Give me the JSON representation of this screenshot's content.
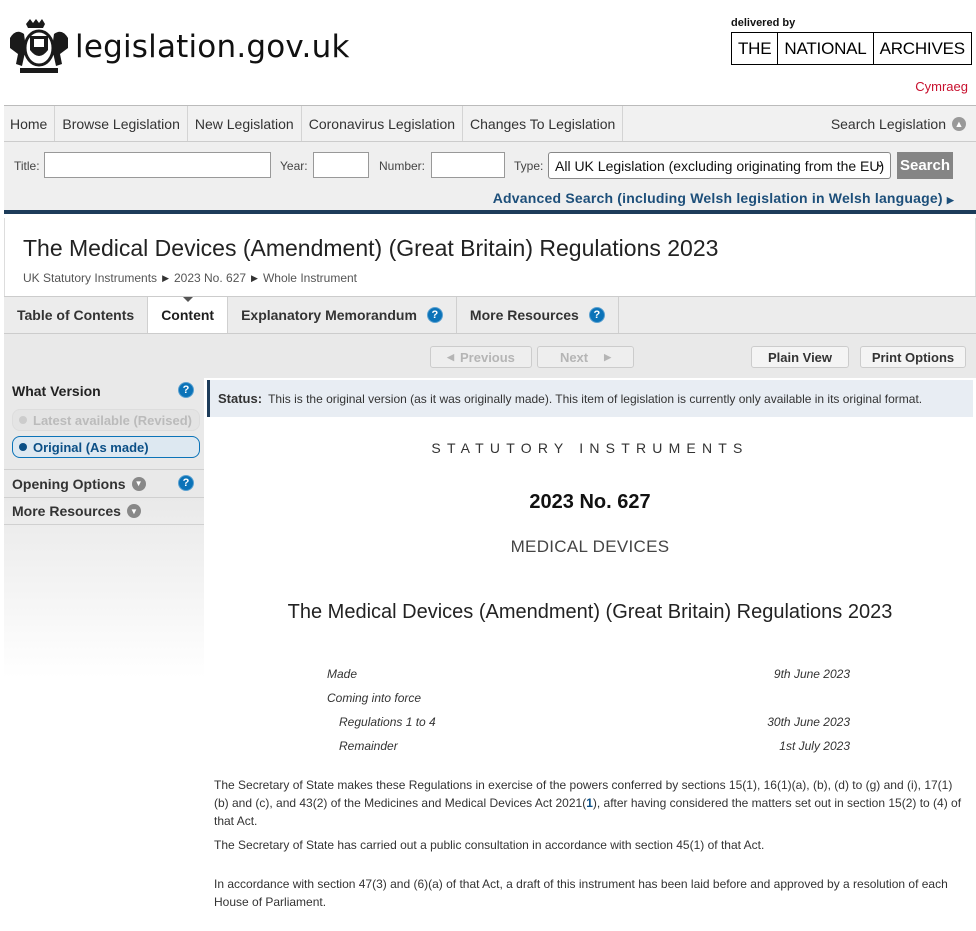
{
  "header": {
    "site_name": "legislation.gov.uk",
    "delivered_by": "delivered by",
    "tna_parts": [
      "THE",
      "NATIONAL",
      "ARCHIVES"
    ],
    "language_link": "Cymraeg"
  },
  "nav": {
    "items": [
      "Home",
      "Browse Legislation",
      "New Legislation",
      "Coronavirus Legislation",
      "Changes To Legislation"
    ],
    "search_label": "Search Legislation"
  },
  "search": {
    "title_label": "Title:",
    "year_label": "Year:",
    "number_label": "Number:",
    "type_label": "Type:",
    "type_value": "All UK Legislation (excluding originating from the EU)",
    "button": "Search",
    "advanced": "Advanced Search (including Welsh legislation in Welsh language)"
  },
  "document": {
    "title": "The Medical Devices (Amendment) (Great Britain) Regulations 2023",
    "breadcrumb": [
      "UK Statutory Instruments",
      "2023 No. 627",
      "Whole Instrument"
    ]
  },
  "tabs": [
    {
      "label": "Table of Contents",
      "help": false
    },
    {
      "label": "Content",
      "help": false
    },
    {
      "label": "Explanatory Memorandum",
      "help": true
    },
    {
      "label": "More Resources",
      "help": true
    }
  ],
  "toolbar": {
    "previous": "Previous",
    "next": "Next",
    "plain_view": "Plain View",
    "print_options": "Print Options"
  },
  "sidebar": {
    "what_version": "What Version",
    "latest": "Latest available (Revised)",
    "original": "Original (As made)",
    "opening_options": "Opening Options",
    "more_resources": "More Resources"
  },
  "status": {
    "label": "Status:",
    "text": "This is the original version (as it was originally made). This item of legislation is currently only available in its original format."
  },
  "content": {
    "heading": "STATUTORY INSTRUMENTS",
    "number": "2023 No. 627",
    "subject": "MEDICAL DEVICES",
    "title": "The Medical Devices (Amendment) (Great Britain) Regulations 2023",
    "dates": [
      {
        "label": "Made",
        "value": "9th June 2023"
      },
      {
        "label": "Coming into force",
        "value": ""
      },
      {
        "label": "Regulations 1 to 4",
        "value": "30th June 2023"
      },
      {
        "label": "Remainder",
        "value": "1st July 2023"
      }
    ],
    "para1_a": "The Secretary of State makes these Regulations in exercise of the powers conferred by sections 15(1), 16(1)(a), (b), (d) to (g) and (i), 17(1) (b) and (c), and 43(2) of the Medicines and Medical Devices Act 2021(",
    "para1_ref": "1",
    "para1_b": "), after having considered the matters set out in section 15(2) to (4) of that Act.",
    "para2": "The Secretary of State has carried out a public consultation in accordance with section 45(1) of that Act.",
    "para3": "In accordance with section 47(3) and (6)(a) of that Act, a draft of this instrument has been laid before and approved by a resolution of each House of Parliament."
  }
}
